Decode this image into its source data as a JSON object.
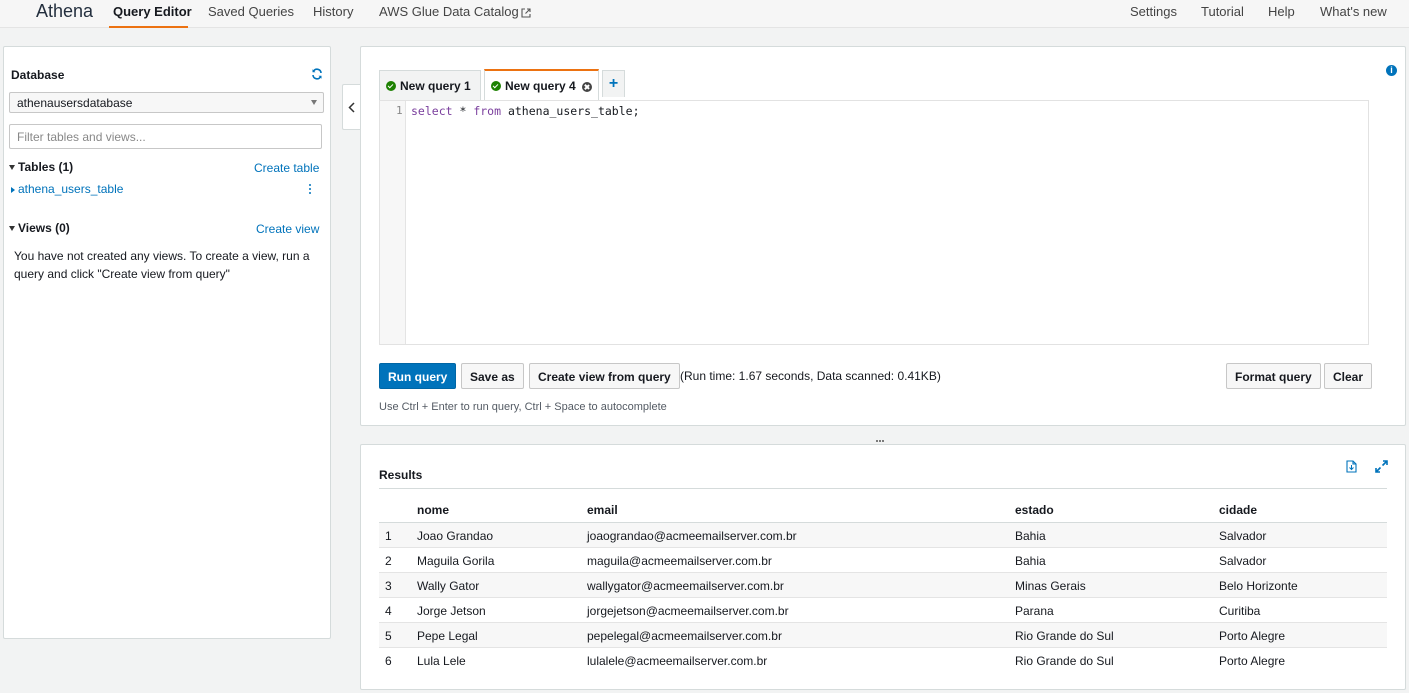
{
  "nav": {
    "brand": "Athena",
    "links": [
      "Query Editor",
      "Saved Queries",
      "History",
      "AWS Glue Data Catalog"
    ],
    "right_links": [
      "Settings",
      "Tutorial",
      "Help",
      "What's new"
    ]
  },
  "left_panel": {
    "database_label": "Database",
    "database_selected": "athenausersdatabase",
    "filter_placeholder": "Filter tables and views...",
    "tables_header": "Tables (1)",
    "create_table": "Create table",
    "tables": [
      "athena_users_table"
    ],
    "views_header": "Views (0)",
    "create_view": "Create view",
    "views_empty_message": "You have not created any views. To create a view, run a query and click \"Create view from query\""
  },
  "editor": {
    "tabs": [
      {
        "label": "New query 1",
        "active": false
      },
      {
        "label": "New query 4",
        "active": true
      }
    ],
    "line_number": "1",
    "code": {
      "kw1": "select",
      "mid1": " * ",
      "kw2": "from",
      "rest": " athena_users_table;"
    },
    "buttons": {
      "run": "Run query",
      "save_as": "Save as",
      "create_view": "Create view from query",
      "format": "Format query",
      "clear": "Clear"
    },
    "run_status": "(Run time: 1.67 seconds, Data scanned: 0.41KB)",
    "hint": "Use Ctrl + Enter to run query, Ctrl + Space to autocomplete"
  },
  "results": {
    "title": "Results",
    "columns": [
      "nome",
      "email",
      "estado",
      "cidade"
    ],
    "rows": [
      {
        "n": "1",
        "nome": "Joao Grandao",
        "email": "joaograndao@acmeemailserver.com.br",
        "estado": "Bahia",
        "cidade": "Salvador"
      },
      {
        "n": "2",
        "nome": "Maguila Gorila",
        "email": "maguila@acmeemailserver.com.br",
        "estado": "Bahia",
        "cidade": "Salvador"
      },
      {
        "n": "3",
        "nome": "Wally Gator",
        "email": "wallygator@acmeemailserver.com.br",
        "estado": "Minas Gerais",
        "cidade": "Belo Horizonte"
      },
      {
        "n": "4",
        "nome": "Jorge Jetson",
        "email": "jorgejetson@acmeemailserver.com.br",
        "estado": "Parana",
        "cidade": "Curitiba"
      },
      {
        "n": "5",
        "nome": "Pepe Legal",
        "email": "pepelegal@acmeemailserver.com.br",
        "estado": "Rio Grande do Sul",
        "cidade": "Porto Alegre"
      },
      {
        "n": "6",
        "nome": "Lula Lele",
        "email": "lulalele@acmeemailserver.com.br",
        "estado": "Rio Grande do Sul",
        "cidade": "Porto Alegre"
      }
    ]
  },
  "colors": {
    "accent": "#ec7211",
    "link": "#0073bb",
    "primary_button": "#0073bb",
    "success": "#1d8102"
  }
}
